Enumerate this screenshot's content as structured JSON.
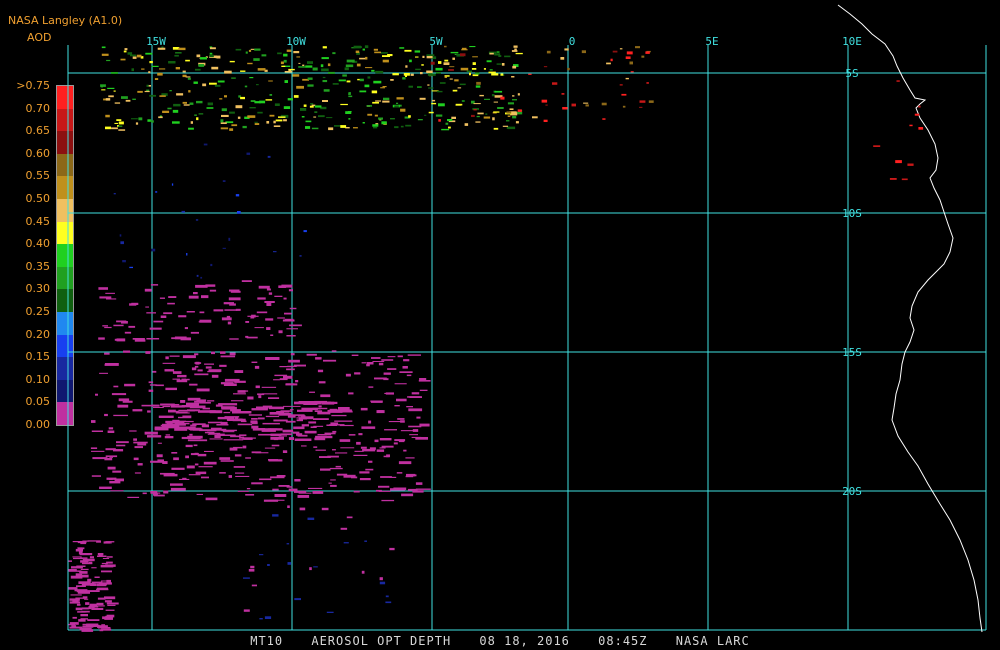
{
  "header": {
    "title": "NASA Langley (A1.0)",
    "product": "AOD"
  },
  "legend": {
    "labels": [
      ">0.75",
      "0.70",
      "0.65",
      "0.60",
      "0.55",
      "0.50",
      "0.45",
      "0.40",
      "0.35",
      "0.30",
      "0.25",
      "0.20",
      "0.15",
      "0.10",
      "0.05",
      "0.00"
    ],
    "colors": [
      "#ff2020",
      "#c81818",
      "#8c1010",
      "#8c6818",
      "#c0901c",
      "#f0c060",
      "#ffff20",
      "#20d020",
      "#20a020",
      "#106010",
      "#2088f0",
      "#1840f0",
      "#1828a0",
      "#101870",
      "#c030a0"
    ]
  },
  "map": {
    "lon_labels": [
      "15W",
      "10W",
      "5W",
      "0",
      "5E",
      "10E"
    ],
    "lat_labels": [
      "5S",
      "10S",
      "15S",
      "20S"
    ],
    "grid_color": "#40e0e0",
    "coast_color": "#ffffff"
  },
  "footer": {
    "sensor": "MT10",
    "product": "AEROSOL OPT DEPTH",
    "date": "08 18, 2016",
    "time": "08:45Z",
    "source": "NASA LARC"
  }
}
